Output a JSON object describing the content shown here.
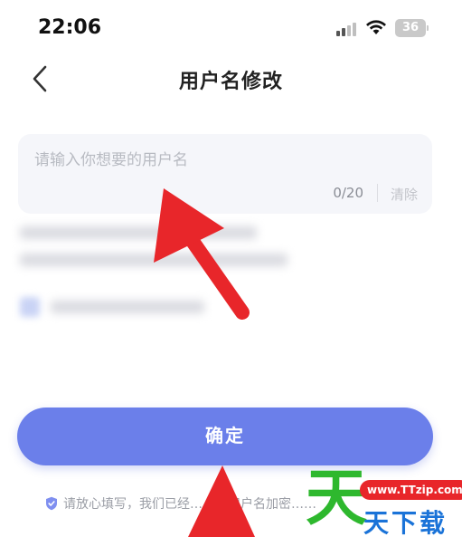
{
  "status_bar": {
    "time": "22:06",
    "battery_level": "36"
  },
  "nav": {
    "title": "用户名修改",
    "back_icon": "chevron-left-icon"
  },
  "username_field": {
    "placeholder": "请输入你想要的用户名",
    "value": "",
    "counter": "0/20",
    "clear_label": "清除"
  },
  "confirm_button": {
    "label": "确定"
  },
  "privacy_note": {
    "icon": "shield-check-icon",
    "text": "请放心填写，我们已经……的用户名加密……"
  },
  "watermark": {
    "main_char": "天",
    "url": "www.TTzip.com",
    "brand_text": "天下载"
  },
  "colors": {
    "accent": "#6b7fea",
    "input_bg": "#f5f6fa",
    "annotation_arrow": "#e8262a",
    "watermark_green": "#2eb82e",
    "watermark_blue": "#1a73d8"
  }
}
